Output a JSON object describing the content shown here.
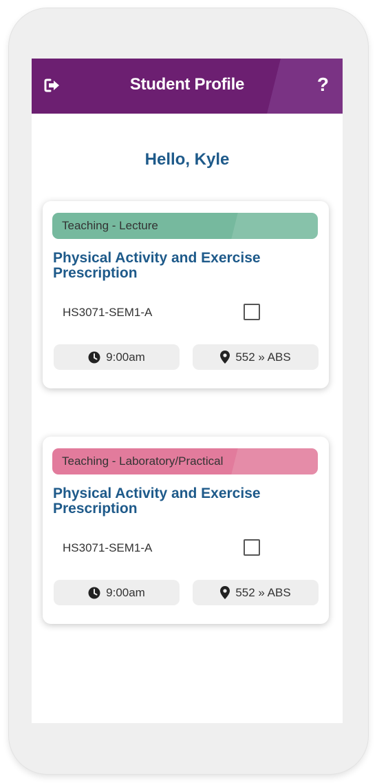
{
  "header": {
    "title": "Student Profile",
    "logout_icon": "logout-icon",
    "help_icon": "help-icon",
    "help_label": "?",
    "color": "#6c1f71"
  },
  "greeting": "Hello, Kyle",
  "cards": [
    {
      "type_label": "Teaching - Lecture",
      "type_color": "#76b99e",
      "title": "Physical Activity and Exercise Prescription",
      "code": "HS3071-SEM1-A",
      "checked": false,
      "time": "9:00am",
      "location": "552 » ABS"
    },
    {
      "type_label": "Teaching - Laboratory/Practical",
      "type_color": "#e27b9c",
      "title": "Physical Activity and Exercise Prescription",
      "code": "HS3071-SEM1-A",
      "checked": false,
      "time": "9:00am",
      "location": "552 » ABS"
    }
  ],
  "colors": {
    "heading": "#1e5a8a",
    "pill_bg": "#eeeeee"
  }
}
